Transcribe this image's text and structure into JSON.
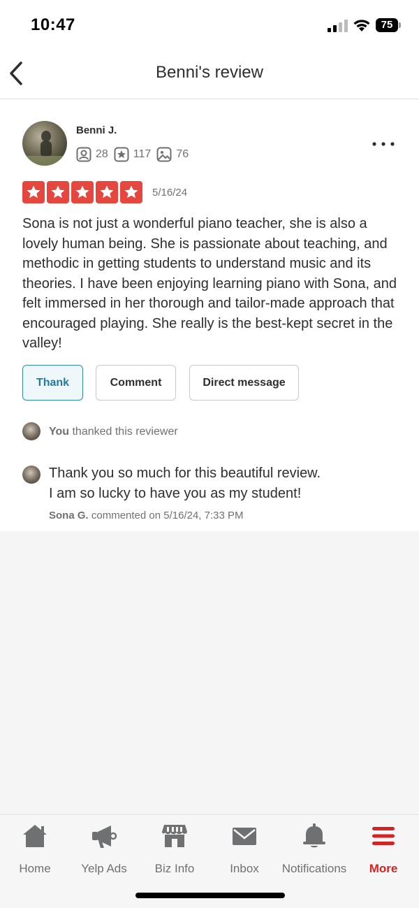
{
  "status_bar": {
    "time": "10:47",
    "battery": "75"
  },
  "header": {
    "title": "Benni's review"
  },
  "review": {
    "reviewer_name": "Benni J.",
    "friends_count": "28",
    "reviews_count": "117",
    "photos_count": "76",
    "rating": 5,
    "date": "5/16/24",
    "text": "Sona is not just a wonderful piano teacher, she is also a lovely human being. She is passionate about teaching, and methodic in getting students to understand music and its theories. I have been enjoying learning piano with Sona, and felt immersed in her thorough and tailor-made approach that encouraged playing. She really is the best-kept secret in the valley!"
  },
  "actions": {
    "thank": "Thank",
    "comment": "Comment",
    "direct_message": "Direct message"
  },
  "thanked": {
    "who": "You",
    "text": " thanked this reviewer"
  },
  "owner_comment": {
    "line1": "Thank you so much for this beautiful review.",
    "line2": "I am so lucky to have you as my student!",
    "author": "Sona G.",
    "meta": " commented on 5/16/24, 7:33 PM"
  },
  "tab_bar": {
    "items": [
      {
        "label": "Home",
        "icon": "home-icon"
      },
      {
        "label": "Yelp Ads",
        "icon": "megaphone-icon"
      },
      {
        "label": "Biz Info",
        "icon": "storefront-icon"
      },
      {
        "label": "Inbox",
        "icon": "envelope-icon"
      },
      {
        "label": "Notifications",
        "icon": "bell-icon"
      },
      {
        "label": "More",
        "icon": "hamburger-icon",
        "active": true
      }
    ]
  },
  "colors": {
    "accent": "#d32323",
    "star": "#e5463e",
    "thank_border": "#2f8ab0"
  }
}
